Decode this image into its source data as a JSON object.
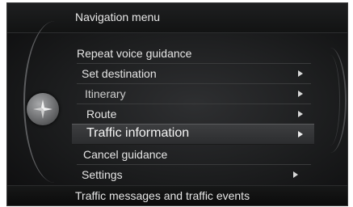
{
  "header": {
    "title": "Navigation menu"
  },
  "menu": {
    "items": [
      {
        "label": "Repeat voice guidance",
        "has_arrow": false
      },
      {
        "label": "Set destination",
        "has_arrow": true
      },
      {
        "label": "Itinerary",
        "has_arrow": true
      },
      {
        "label": "Route",
        "has_arrow": true
      },
      {
        "label": "Traffic information",
        "has_arrow": true,
        "selected": true
      },
      {
        "label": "Cancel guidance",
        "has_arrow": false
      },
      {
        "label": "Settings",
        "has_arrow": true
      }
    ]
  },
  "footer": {
    "status": "Traffic messages and traffic events"
  },
  "icons": {
    "dial": "compass-icon",
    "submenu": "arrow-right-icon"
  },
  "colors": {
    "background": "#1b1c1d",
    "text": "#e6e6e6",
    "selection": "#3d3e40"
  }
}
